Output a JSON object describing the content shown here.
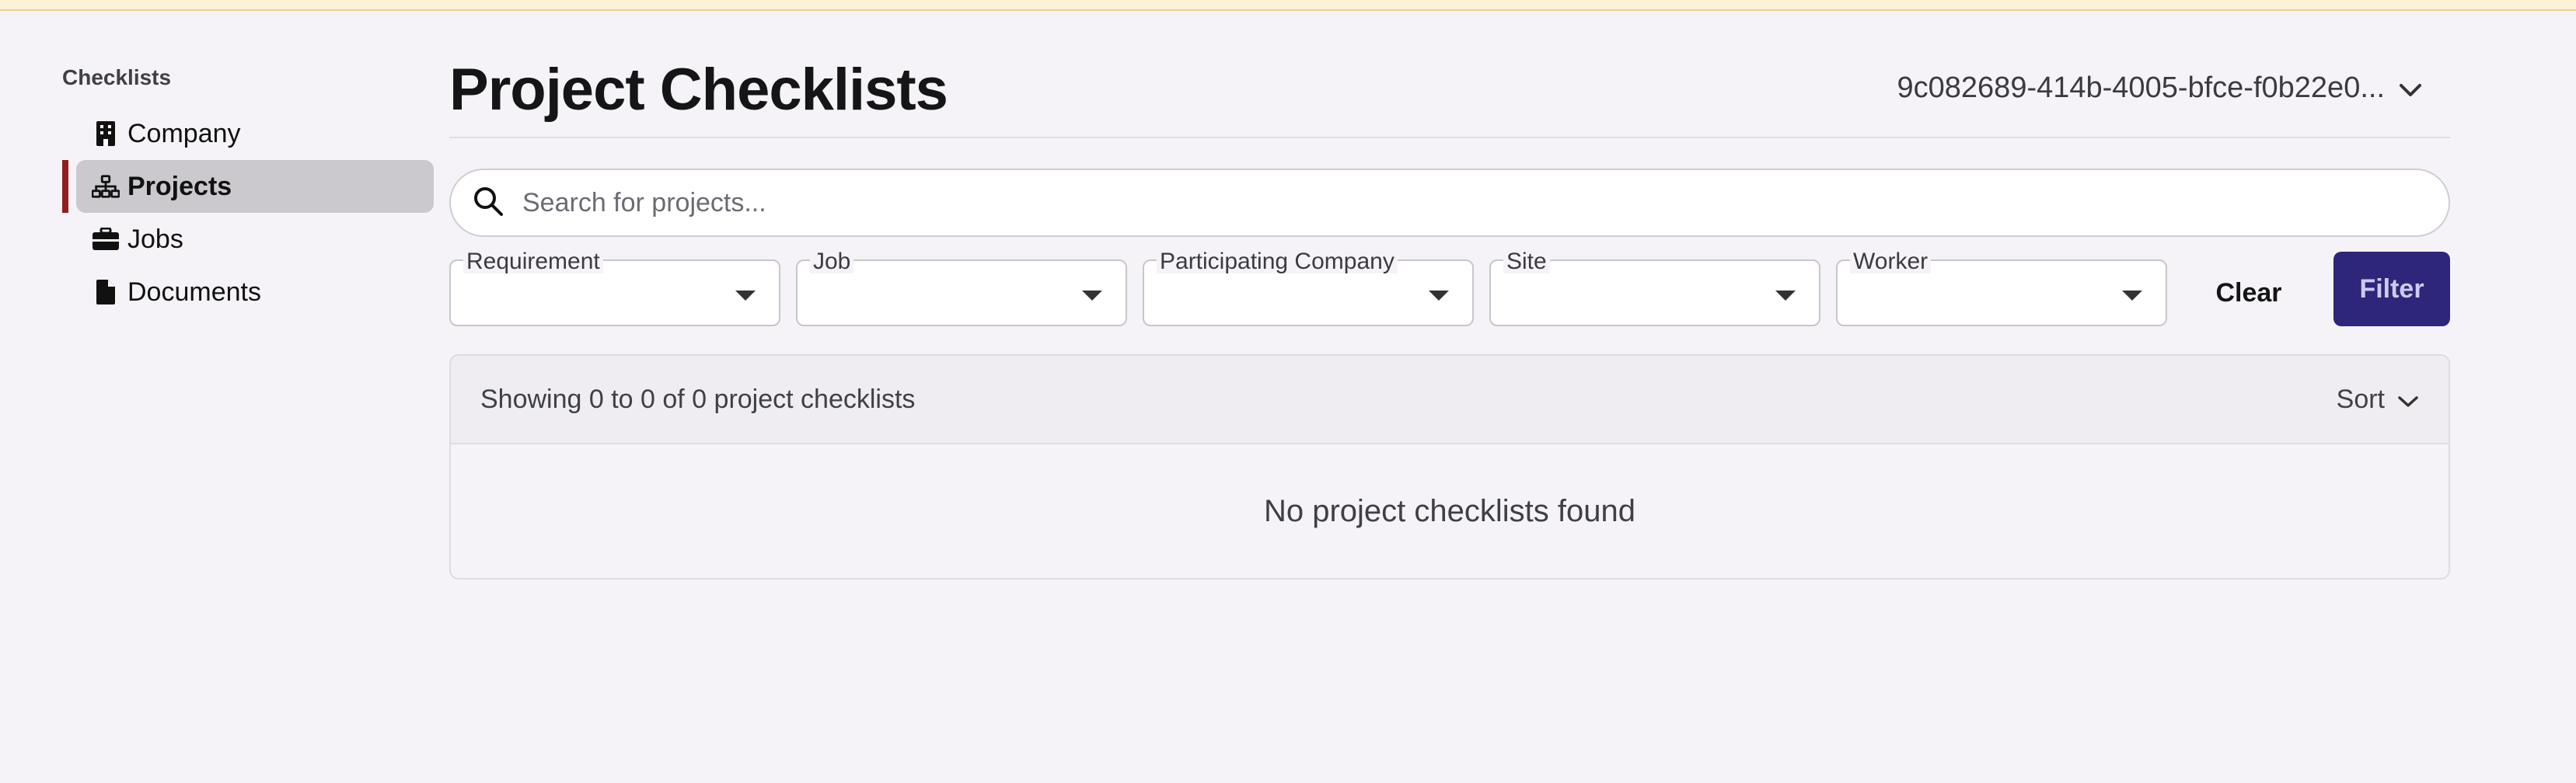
{
  "sidebar": {
    "heading": "Checklists",
    "items": [
      {
        "label": "Company",
        "icon": "building-icon",
        "active": false
      },
      {
        "label": "Projects",
        "icon": "sitemap-icon",
        "active": true
      },
      {
        "label": "Jobs",
        "icon": "briefcase-icon",
        "active": false
      },
      {
        "label": "Documents",
        "icon": "file-icon",
        "active": false
      }
    ]
  },
  "header": {
    "title": "Project Checklists",
    "project_id": "9c082689-414b-4005-bfce-f0b22e0..."
  },
  "search": {
    "placeholder": "Search for projects...",
    "value": ""
  },
  "filters": {
    "fields": [
      {
        "label": "Requirement",
        "value": ""
      },
      {
        "label": "Job",
        "value": ""
      },
      {
        "label": "Participating Company",
        "value": ""
      },
      {
        "label": "Site",
        "value": ""
      },
      {
        "label": "Worker",
        "value": ""
      }
    ],
    "clear_label": "Clear",
    "filter_label": "Filter"
  },
  "results": {
    "showing": "Showing 0 to 0 of 0 project checklists",
    "sort_label": "Sort",
    "empty_message": "No project checklists found"
  },
  "colors": {
    "accent": "#2e267a",
    "active_bar": "#8f1d1d",
    "background": "#f5f3f7"
  }
}
